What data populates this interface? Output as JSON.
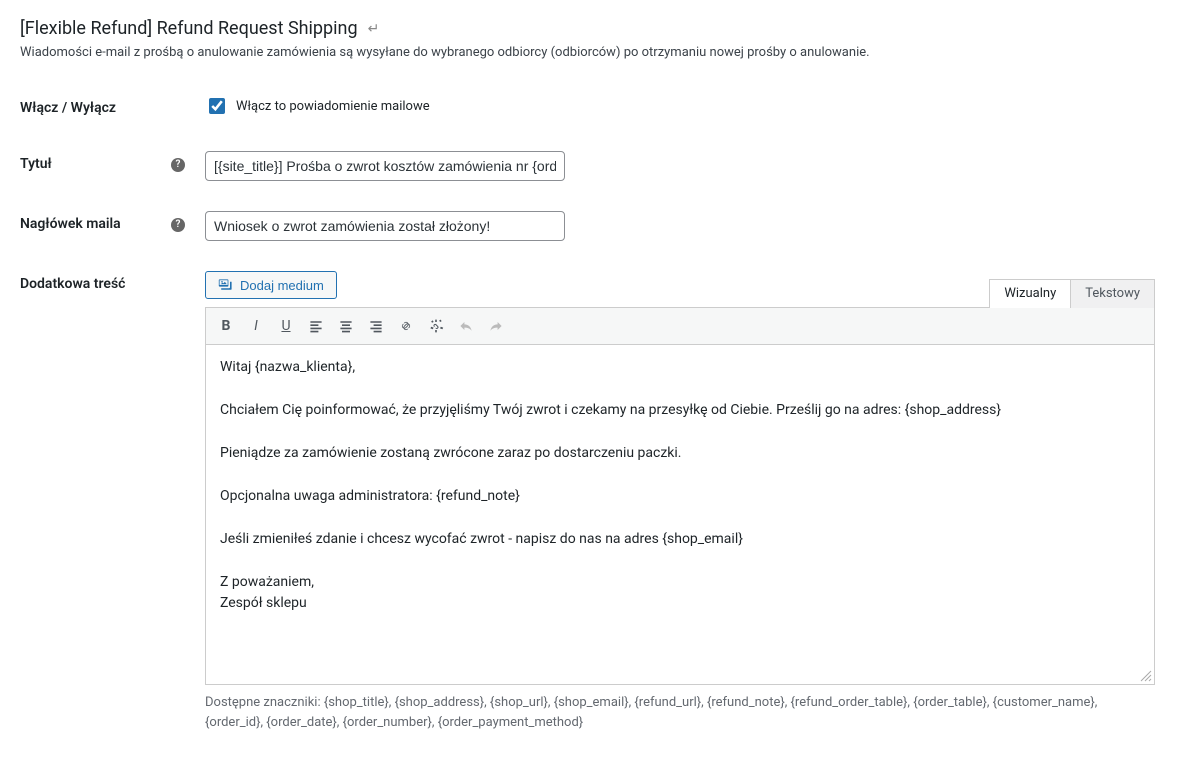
{
  "header": {
    "title": "[Flexible Refund] Refund Request Shipping",
    "back_symbol": "↵"
  },
  "description": "Wiadomości e-mail z prośbą o anulowanie zamówienia są wysyłane do wybranego odbiorcy (odbiorców) po otrzymaniu nowej prośby o anulowanie.",
  "fields": {
    "enable": {
      "label": "Włącz / Wyłącz",
      "checkbox_label": "Włącz to powiadomienie mailowe",
      "checked": true
    },
    "subject": {
      "label": "Tytuł",
      "value": "[{site_title}] Prośba o zwrot kosztów zamówienia nr {order_number}"
    },
    "heading": {
      "label": "Nagłówek maila",
      "value": "Wniosek o zwrot zamówienia został złożony!"
    },
    "content": {
      "label": "Dodatkowa treść",
      "add_media_label": "Dodaj medium",
      "tabs": {
        "visual": "Wizualny",
        "text": "Tekstowy"
      },
      "body": {
        "p1": "Witaj {nazwa_klienta},",
        "p2": "Chciałem Cię poinformować, że przyjęliśmy Twój zwrot i czekamy na przesyłkę od Ciebie. Prześlij go na adres: {shop_address}",
        "p3": "Pieniądze za zamówienie zostaną zwrócone zaraz po dostarczeniu paczki.",
        "p4": "Opcjonalna uwaga administratora: {refund_note}",
        "p5": "Jeśli zmieniłeś zdanie i chcesz wycofać zwrot - napisz do nas na adres {shop_email}",
        "p6a": "Z poważaniem,",
        "p6b": "Zespół sklepu"
      }
    }
  },
  "tokens_label": "Dostępne znaczniki: {shop_title}, {shop_address}, {shop_url}, {shop_email}, {refund_url}, {refund_note}, {refund_order_table}, {order_table}, {customer_name}, {order_id}, {order_date}, {order_number}, {order_payment_method}"
}
